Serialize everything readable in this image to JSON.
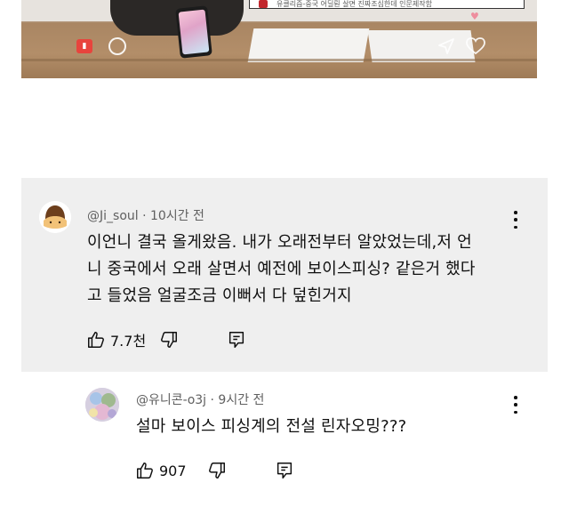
{
  "video": {
    "caption": "유클리즘-중국 어딜뤈 살면 진짜조심한데 인문제작함"
  },
  "comments": [
    {
      "author": "@Ji_soul",
      "separator": "·",
      "time": "10시간 전",
      "lines": [
        "이언니 결국 올게왔음. 내가 오래전부터 알았었는데,저 언",
        "니 중국에서 오래 살면서 예전에 보이스피싱? 같은거 했다",
        "고 들었음 얼굴조금 이뻐서 다 덮힌거지"
      ],
      "likes": "7.7천",
      "highlighted": true
    },
    {
      "author": "@유니콘-o3j",
      "separator": "·",
      "time": "9시간 전",
      "lines": [
        "설마 보이스 피싱계의 전설 린자오밍???"
      ],
      "likes": "907",
      "highlighted": false
    }
  ],
  "icons": [
    "thumbs-up-icon",
    "thumbs-down-icon",
    "reply-icon",
    "more-vert-icon"
  ],
  "colors": {
    "highlight_bg": "#efefef",
    "meta_text": "#606060",
    "body_text": "#0f0f0f"
  }
}
